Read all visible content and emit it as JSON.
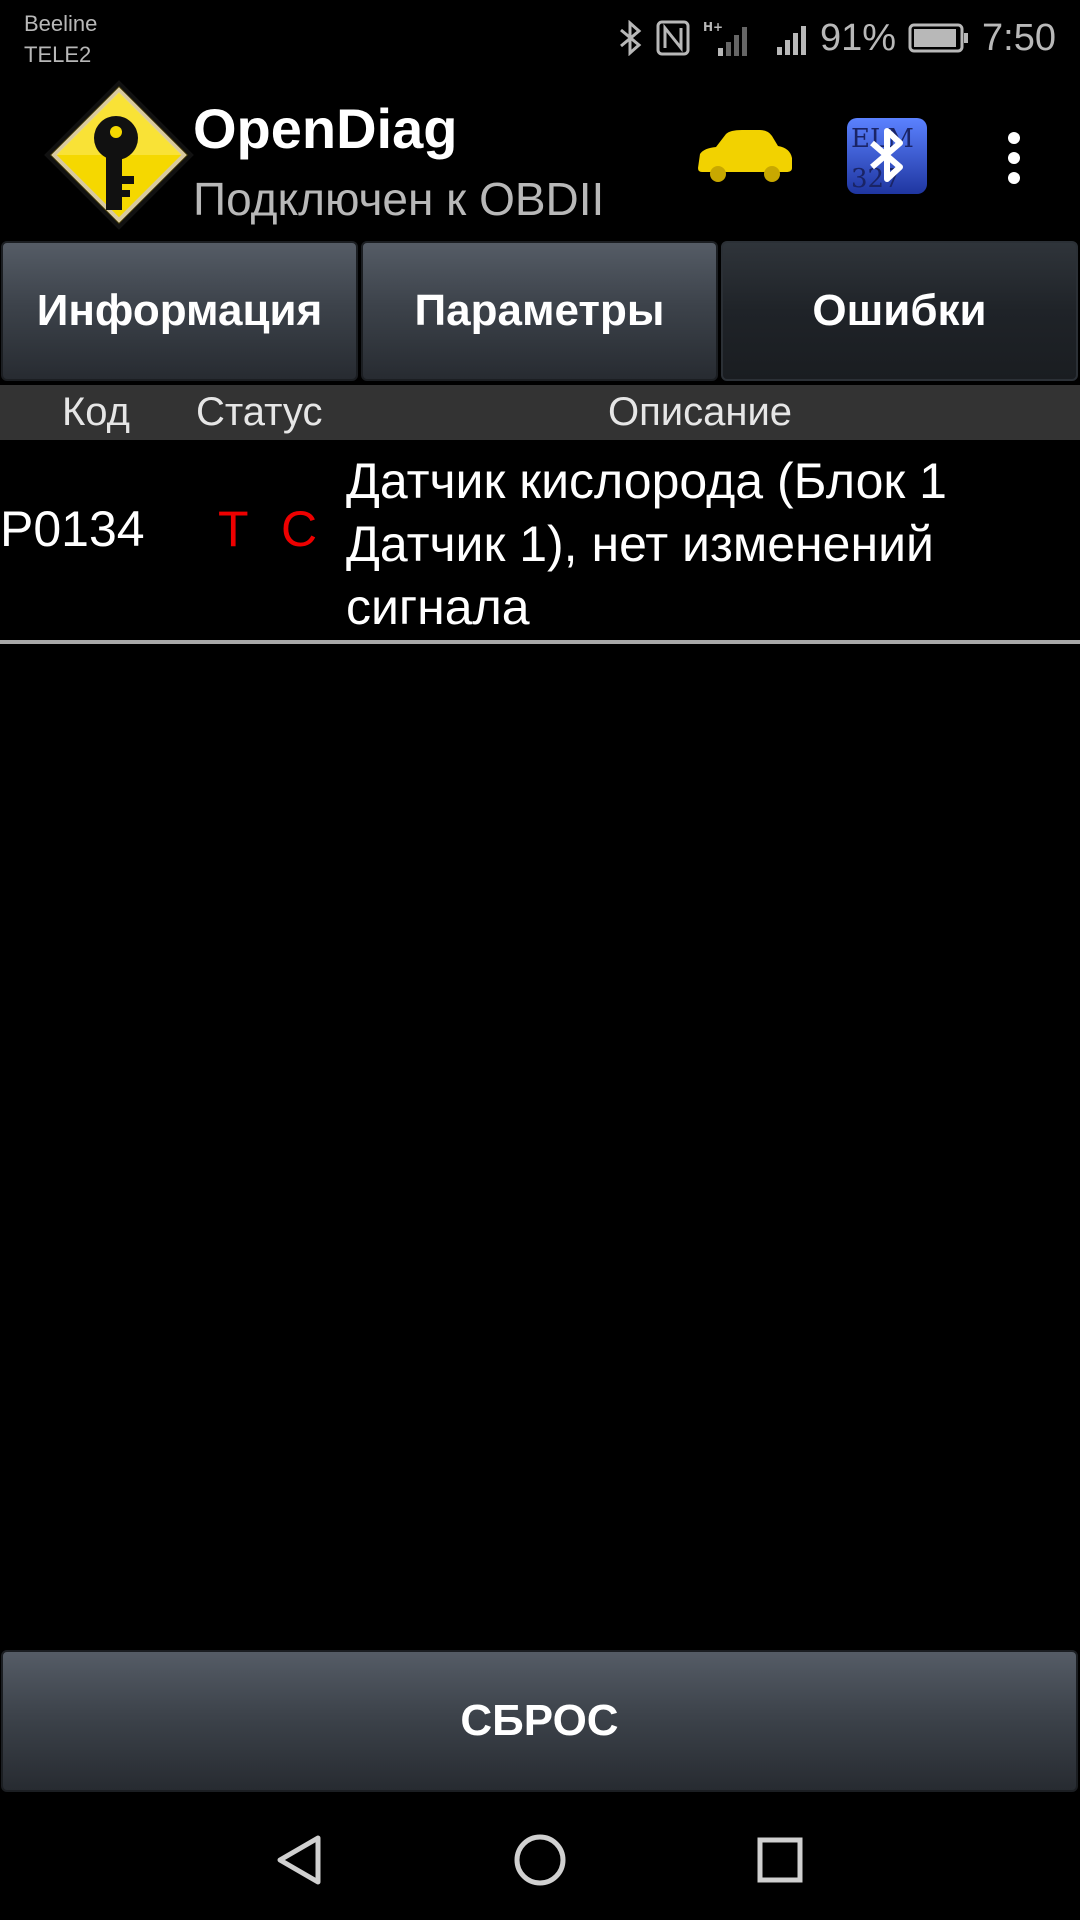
{
  "status_bar": {
    "carrier_1": "Beeline",
    "carrier_2": "TELE2",
    "battery": "91%",
    "time": "7:50"
  },
  "app_bar": {
    "title": "OpenDiag",
    "subtitle": "Подключен к OBDII",
    "icons": [
      "app-key-logo",
      "car-icon",
      "bluetooth-elm327-icon",
      "overflow-menu-icon"
    ],
    "colors": {
      "car": "#f2d200",
      "logo": "#f5d800",
      "bluetooth": "#2f55c8"
    }
  },
  "tabs": [
    {
      "label": "Информация",
      "active": false
    },
    {
      "label": "Параметры",
      "active": false
    },
    {
      "label": "Ошибки",
      "active": true
    }
  ],
  "table": {
    "headers": {
      "code": "Код",
      "status": "Статус",
      "description": "Описание"
    },
    "rows": [
      {
        "code": "P0134",
        "status_flags": [
          "T",
          "C"
        ],
        "status_color": "#e00000",
        "description": "Датчик кислорода (Блок 1 Датчик 1), нет изменений сигнала"
      }
    ]
  },
  "reset_label": "СБРОС",
  "nav": [
    "back-icon",
    "home-icon",
    "recents-icon"
  ]
}
